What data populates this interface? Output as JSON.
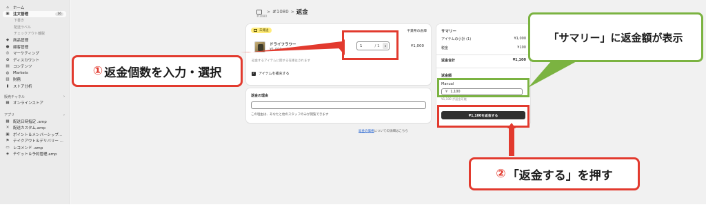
{
  "sidebar": {
    "items": [
      {
        "label": "ホーム",
        "icon": "home-icon"
      },
      {
        "label": "注文管理",
        "icon": "orders-icon",
        "badge": "16",
        "active": true
      },
      {
        "label": "下書き",
        "sub": true
      },
      {
        "label": "配送ラベル",
        "sub": true
      },
      {
        "label": "チェックアウト離脱",
        "sub": true
      },
      {
        "label": "商品管理",
        "icon": "tag-icon"
      },
      {
        "label": "顧客管理",
        "icon": "person-icon"
      },
      {
        "label": "マーケティング",
        "icon": "target-icon"
      },
      {
        "label": "ディスカウント",
        "icon": "discount-icon"
      },
      {
        "label": "コンテンツ",
        "icon": "content-icon"
      },
      {
        "label": "Markets",
        "icon": "globe-icon"
      },
      {
        "label": "財務",
        "icon": "bank-icon"
      },
      {
        "label": "ストア分析",
        "icon": "chart-icon"
      }
    ],
    "sales_section": "販売チャネル",
    "sales_items": [
      {
        "label": "オンラインストア",
        "icon": "store-icon"
      }
    ],
    "apps_section": "アプリ",
    "apps_items": [
      {
        "label": "配送日時指定 .amp"
      },
      {
        "label": "配送カスタム.amp"
      },
      {
        "label": "ポイント＆メンバーシップ..."
      },
      {
        "label": "テイクアウト＆デリバリー ..."
      },
      {
        "label": "レコメンド .amp"
      },
      {
        "label": "チケット＆予約管理.amp"
      }
    ]
  },
  "header": {
    "order_number": "#1080",
    "sep": ">",
    "title": "返金",
    "order_sub": "#1080"
  },
  "items_card": {
    "status": "未発送",
    "location": "千葉県の倉庫",
    "product_name": "ドライフラワー",
    "product_price": "¥1,000 × 1",
    "qty_value": "1",
    "qty_of": "/ 1",
    "line_total": "¥1,000",
    "restock_note": "返金するアイテムに関する在庫はされます",
    "restock_label": "アイテムを補充する"
  },
  "reason_card": {
    "label": "返金の理由",
    "help": "この理由は、あなたと他のスタッフのみが閲覧できます"
  },
  "policy": {
    "link": "返金の価格",
    "text": "についての詳細はこちら"
  },
  "summary": {
    "title": "サマリー",
    "rows": [
      {
        "label": "アイテムの小計 (1)",
        "value": "¥1,000"
      },
      {
        "label": "税金",
        "value": "¥100"
      },
      {
        "label": "返金合計",
        "value": "¥1,100"
      }
    ],
    "refund_label": "返金額",
    "manual": "Manual",
    "currency": "¥",
    "amount": "1,100",
    "available": "¥1,100 が返金可能",
    "button": "¥1,100を返金する"
  },
  "annotations": {
    "step1": "返金個数を入力・選択",
    "step1_num": "①",
    "step2": "「返金する」を押す",
    "step2_num": "②",
    "summary_note": "「サマリー」に返金額が表示"
  }
}
